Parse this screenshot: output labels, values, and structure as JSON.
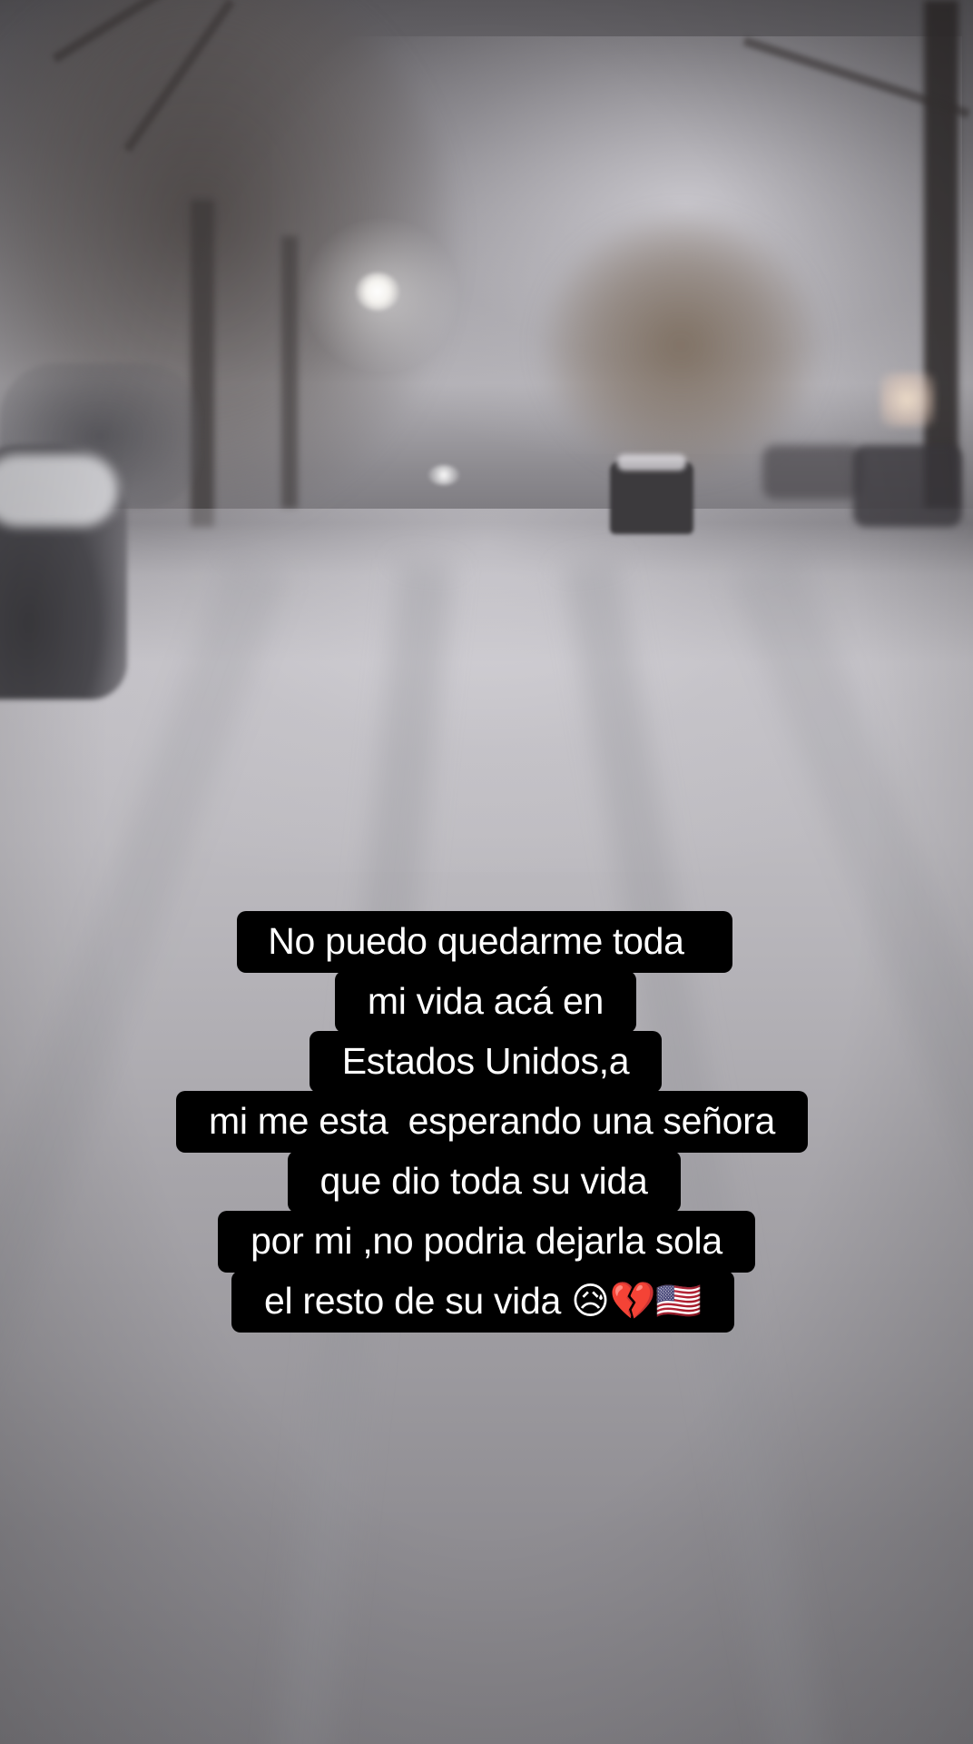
{
  "caption": {
    "lines": [
      "No puedo quedarme toda ",
      "mi vida acá en",
      "Estados Unidos,a",
      "mi me esta  esperando una señora",
      "que dio toda su vida",
      "por mi ,no podria dejarla sola",
      "el resto de su vida 😥💔🇺🇸"
    ]
  },
  "colors": {
    "caption_background": "#000000",
    "caption_text": "#ffffff"
  }
}
